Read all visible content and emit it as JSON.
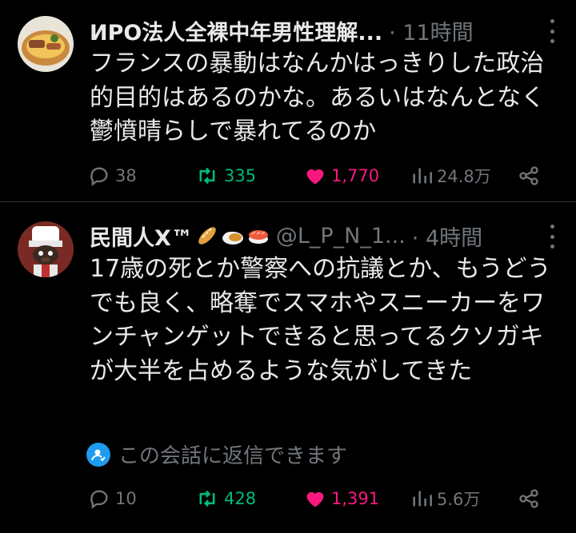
{
  "tweets": [
    {
      "name": "ИPO法人全裸中年男性理解...",
      "handle": "",
      "time": "· 11時間",
      "text": "フランスの暴動はなんかはっきりした政治的目的はあるのかな。あるいはなんとなく鬱憤晴らしで暴れてるのか",
      "replies": "38",
      "retweets": "335",
      "likes": "1,770",
      "views": "24.8万"
    },
    {
      "name": "民間人X™",
      "handle": "@L_P_N_1...",
      "time": "· 4時間",
      "text": "17歳の死とか警察への抗議とか、もうどうでも良く、略奪でスマホやスニーカーをワンチャンゲットできると思ってるクソガキが大半を占めるような気がしてきた",
      "reply_hint": "この会話に返信できます",
      "replies": "10",
      "retweets": "428",
      "likes": "1,391",
      "views": "5.6万"
    }
  ],
  "colors": {
    "background": "#000000",
    "text": "#e7e9ea",
    "muted": "#71767b",
    "retweet": "#00ba7c",
    "like": "#f91880",
    "accent": "#1d9bf0"
  },
  "icons": [
    "reply-icon",
    "retweet-icon",
    "heart-icon",
    "views-icon",
    "share-icon",
    "more-icon",
    "mention-icon",
    "baguette-emoji",
    "curry-rice-emoji",
    "sushi-emoji"
  ]
}
